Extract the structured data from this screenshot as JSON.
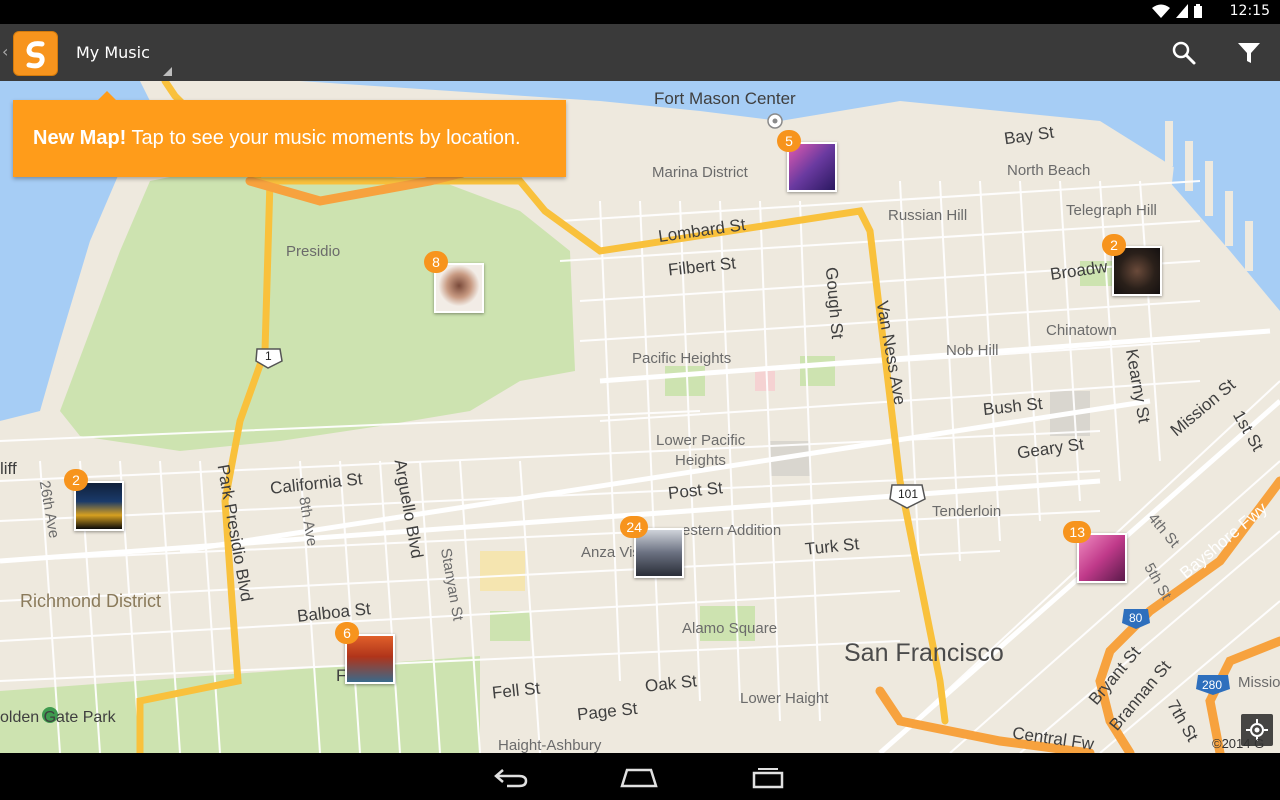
{
  "status_bar": {
    "time": "12:15",
    "icons": [
      "wifi-icon",
      "signal-icon",
      "battery-icon"
    ]
  },
  "action_bar": {
    "app_icon": "soundhound-logo-icon",
    "title": "My Music",
    "actions": [
      "search-icon",
      "filter-icon"
    ]
  },
  "banner": {
    "bold": "New Map!",
    "text": " Tap to see your music moments by location."
  },
  "map": {
    "labels": {
      "fort_mason": "Fort Mason Center",
      "marina": "Marina District",
      "bay_st": "Bay St",
      "north_beach": "North Beach",
      "russian_hill": "Russian Hill",
      "telegraph_hill": "Telegraph Hill",
      "lombard": "Lombard St",
      "filbert": "Filbert St",
      "presidio": "Presidio",
      "gough": "Gough St",
      "van_ness": "Van Ness Ave",
      "broadway": "Broadw",
      "chinatown": "Chinatown",
      "nob_hill": "Nob Hill",
      "pacific_heights": "Pacific Heights",
      "kearny": "Kearny St",
      "bush": "Bush St",
      "mission": "Mission St",
      "first_st": "1st St",
      "lower_pac_1": "Lower Pacific",
      "lower_pac_2": "Heights",
      "geary": "Geary St",
      "cliff": "liff",
      "ave26": "26th Ave",
      "park_presidio": "Park Presidio Blvd",
      "california": "California St",
      "arguello": "Arguello Blvd",
      "ave8": "8th Ave",
      "post": "Post St",
      "tenderloin": "Tenderloin",
      "hwy101": "101",
      "hwy1": "1",
      "western_add": "estern Addition",
      "anza": "Anza Vis",
      "turk": "Turk St",
      "st4": "4th St",
      "bayshore": "Bayshore Fwy",
      "richmond": "Richmond District",
      "stanyan": "Stanyan St",
      "balboa": "Balboa St",
      "st5": "5th St",
      "alamo": "Alamo Square",
      "i80": "80",
      "sf": "San Francisco",
      "f_st": "F",
      "fell": "Fell St",
      "oak": "Oak St",
      "bryant": "Bryant St",
      "brannan": "Brannan St",
      "i280": "280",
      "mission_right": "Missio",
      "golden_gate": "olden Gate Park",
      "page": "Page St",
      "lower_haight": "Lower Haight",
      "haight": "Haight-Ashbury",
      "central": "Central Fw",
      "st7": "7th St"
    },
    "pins": [
      {
        "count": "5"
      },
      {
        "count": "8"
      },
      {
        "count": "2"
      },
      {
        "count": "2"
      },
      {
        "count": "24"
      },
      {
        "count": "13"
      },
      {
        "count": "6"
      }
    ],
    "copyright": "©2014 G",
    "locate_icon": "my-location-icon"
  },
  "nav_bar": {
    "buttons": [
      "back-icon",
      "home-icon",
      "recent-apps-icon"
    ]
  },
  "colors": {
    "accent": "#ff9c1a",
    "action_bar": "#3a3a3a",
    "highway": "#f9c13c",
    "park": "#cde3b0",
    "water": "#a6cdf5",
    "land": "#eee9de"
  }
}
